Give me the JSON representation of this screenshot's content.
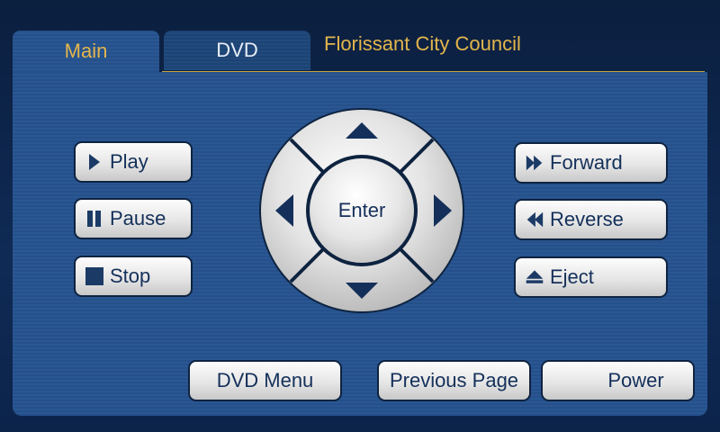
{
  "tabs": [
    {
      "label": "Main"
    },
    {
      "label": "DVD"
    }
  ],
  "header": {
    "title": "Florissant City Council"
  },
  "colors": {
    "accent": "#e3b64c",
    "panel": "#25508a",
    "button_text": "#14305a"
  },
  "transport": {
    "play": {
      "label": "Play",
      "icon": "play-icon"
    },
    "pause": {
      "label": "Pause",
      "icon": "pause-icon"
    },
    "stop": {
      "label": "Stop",
      "icon": "stop-icon"
    },
    "forward": {
      "label": "Forward",
      "icon": "fast-forward-icon"
    },
    "reverse": {
      "label": "Reverse",
      "icon": "rewind-icon"
    },
    "eject": {
      "label": "Eject",
      "icon": "eject-icon"
    }
  },
  "dpad": {
    "enter_label": "Enter"
  },
  "footer": {
    "dvd_menu": "DVD Menu",
    "previous_page": "Previous Page",
    "power": "Power"
  }
}
